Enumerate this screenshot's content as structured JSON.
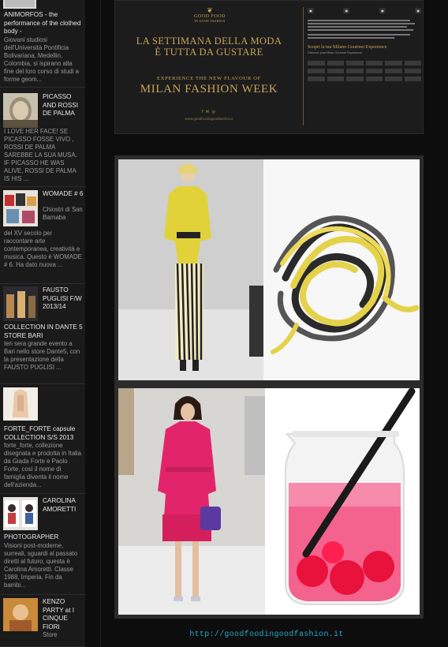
{
  "sidebar": {
    "posts": [
      {
        "title": "ANIMORFOS - the performance of the clothed body -",
        "excerpt": "Giovani studiosi dell'Università Pontificia Bolivariana, Medellin, Colombia, si ispirano alla fine del loro corso di studi a forme geom..."
      },
      {
        "title": "PICASSO AND ROSSI DE PALMA",
        "excerpt": "I LOVE HER FACE! SE PICASSO FOSSE VIVO , ROSSI DE PALMA SAREBBE LA SUA MUSA. IF PICASSO HE WAS ALIVE, ROSSI DE PALMA IS HIS ..."
      },
      {
        "title": "WOMADE # 6",
        "excerpt_top": "Chiostri di San Barnaba",
        "excerpt": "del XV secolo per raccontare arte contemporanea, creatività e musica. Questo è   WOMADE # 6. Ha dato nuova ..."
      },
      {
        "title": "FAUSTO PUGLISI F/W 2013/14",
        "title_cont": "COLLECTION IN DANTE 5 STORE BARI",
        "excerpt": "Ieri sera grande evento a Bari nello store Dante5, con la presentazione della FAUSTO PUGLISI ..."
      },
      {
        "title": "FORTE_FORTE capsule COLLECTION S/S 2013",
        "excerpt": "forte_forte, collezione disegnata e prodotta in Italia da Giada Forte e Paolo Forte, così il   nome di famiglia diventa il nome dell'azienda..."
      },
      {
        "title": "CAROLINA AMORETTI",
        "title_cont": "PHOTOGRAPHER",
        "excerpt": "Visioni post-moderne, surreali, sguardi al passato diretti al futuro, questa è Carolina Amoretti. Classe 1988, Imperia. Fin da bambi..."
      },
      {
        "title": "KENZO PARTY at I CINQUE FIORI",
        "excerpt": "Store"
      }
    ]
  },
  "banner": {
    "logo_line1": "GOOD FOOD",
    "logo_line2": "IN GOOD FASHION",
    "headline_1": "LA SETTIMANA DELLA MODA",
    "headline_2": "È TUTTA DA GUSTARE",
    "subhead": "EXPERIENCE THE NEW FLAVOUR OF",
    "event": "MILAN FASHION WEEK",
    "url": "www.goodfoodingoodfashion.it",
    "scopri": "Scopri la tua Milano Gourmet Experience",
    "discover": "Discover your Milan Gourmet Experience"
  },
  "footer": {
    "link": "http://goodfoodingoodfashion.it"
  },
  "colors": {
    "gold": "#c8a45a",
    "link": "#2aa7c9",
    "sidebar_bg": "#1a1a1a"
  }
}
